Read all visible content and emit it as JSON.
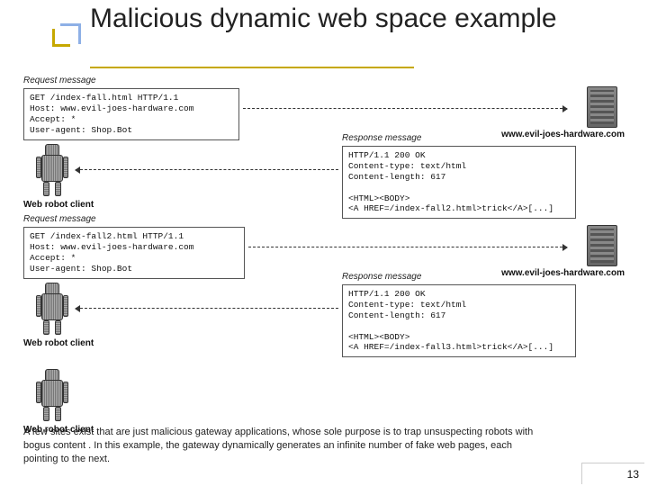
{
  "title": "Malicious dynamic web space example",
  "labels": {
    "request": "Request message",
    "response": "Response message",
    "robot": "Web robot client",
    "server": "www.evil-joes-hardware.com"
  },
  "req1": "GET /index-fall.html HTTP/1.1\nHost: www.evil-joes-hardware.com\nAccept: *\nUser-agent: Shop.Bot",
  "resp1": "HTTP/1.1 200 OK\nContent-type: text/html\nContent-length: 617\n\n<HTML><BODY>\n<A HREF=/index-fall2.html>trick</A>[...]",
  "req2": "GET /index-fall2.html HTTP/1.1\nHost: www.evil-joes-hardware.com\nAccept: *\nUser-agent: Shop.Bot",
  "resp2": "HTTP/1.1 200 OK\nContent-type: text/html\nContent-length: 617\n\n<HTML><BODY>\n<A HREF=/index-fall3.html>trick</A>[...]",
  "caption": "A few sites exist that are just malicious gateway applications, whose sole purpose is to trap unsuspecting robots with bogus content . In this example, the gateway dynamically generates an infinite number of fake web pages, each pointing to the next.",
  "page": "13"
}
